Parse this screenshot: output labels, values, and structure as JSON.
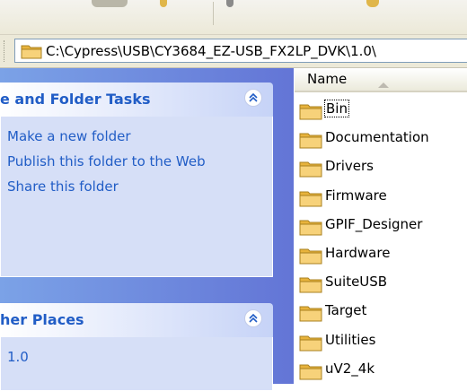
{
  "address": {
    "path": "C:\\Cypress\\USB\\CY3684_EZ-USB_FX2LP_DVK\\1.0\\"
  },
  "tasks": {
    "title": "e and Folder Tasks",
    "links": [
      "Make a new folder",
      "Publish this folder to the Web",
      "Share this folder"
    ]
  },
  "places": {
    "title": "her Places",
    "items": [
      "1.0"
    ]
  },
  "filelist": {
    "column_name": "Name",
    "files": [
      "Bin",
      "Documentation",
      "Drivers",
      "Firmware",
      "GPIF_Designer",
      "Hardware",
      "SuiteUSB",
      "Target",
      "Utilities",
      "uV2_4k"
    ]
  },
  "colors": {
    "link": "#215dc6",
    "folder": "#f3c75a",
    "pane": "#d6dff7"
  },
  "icons": {
    "folder": "folder-icon",
    "collapse": "chevron-up-icon",
    "sort": "sort-ascending-icon"
  }
}
